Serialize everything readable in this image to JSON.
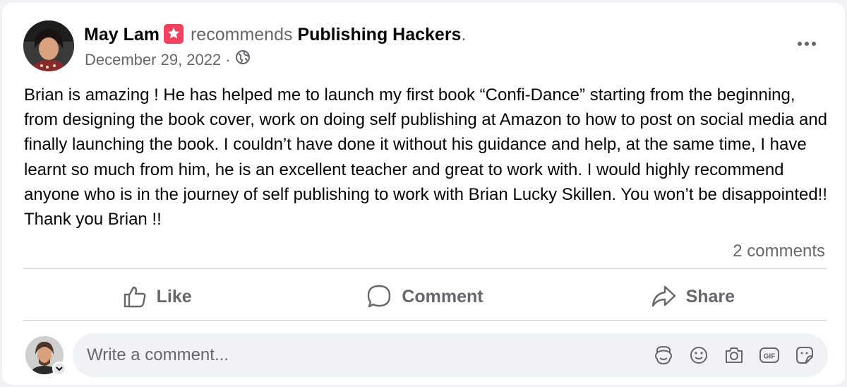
{
  "post": {
    "author": "May Lam",
    "recommends_text": "recommends",
    "page_name": "Publishing Hackers",
    "period": ".",
    "date": "December 29, 2022",
    "date_separator": "·",
    "body": "Brian is amazing ! He has helped me to launch my first book “Confi-Dance” starting from the beginning, from designing the book cover, work on doing self publishing at Amazon to how to post on social media and finally launching the book. I couldn’t have done it without his guidance and help, at the same time, I have learnt so much from him, he is an excellent teacher and great to work with. I would highly recommend anyone who is in the journey of self publishing to work with Brian Lucky Skillen. You won’t be disappointed!! Thank you Brian !!",
    "comments_count": "2 comments"
  },
  "actions": {
    "like": "Like",
    "comment": "Comment",
    "share": "Share"
  },
  "comment_box": {
    "placeholder": "Write a comment..."
  },
  "icons": {
    "recommend_badge": "star-badge-icon",
    "audience": "globe-icon",
    "more": "more-options-icon",
    "like": "thumbs-up-icon",
    "comment": "speech-bubble-icon",
    "share": "share-arrow-icon",
    "avatar_sticker": "avatar-sticker-icon",
    "emoji": "smiley-icon",
    "camera": "camera-icon",
    "gif": "gif-icon",
    "sticker": "sticker-icon"
  },
  "colors": {
    "recommend_badge": "#f3425f",
    "secondary_text": "#65676b",
    "comment_box_bg": "#f0f2f5"
  }
}
